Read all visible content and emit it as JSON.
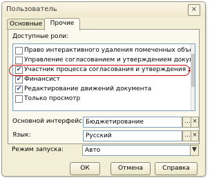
{
  "window": {
    "title": "Пользователь",
    "close_label": "×"
  },
  "tabs": [
    {
      "label": "Основные"
    },
    {
      "label": "Прочие"
    }
  ],
  "roles": {
    "label": "Доступные роли:",
    "items": [
      {
        "label": "Право интерактивного удаления помеченных объектов",
        "checked": false
      },
      {
        "label": "Управление согласованием и утверждением документов",
        "checked": false
      },
      {
        "label": "Участник процесса согласования и утверждения доку...",
        "checked": true
      },
      {
        "label": "Финансист",
        "checked": true
      },
      {
        "label": "Редактирование движений документа",
        "checked": true
      },
      {
        "label": "Только просмотр",
        "checked": false
      }
    ]
  },
  "fields": {
    "interface": {
      "label": "Основной интерфейс:",
      "value": "Бюджетирование"
    },
    "language": {
      "label": "Язык:",
      "value": "Русский"
    },
    "launch_mode": {
      "label": "Режим запуска:",
      "value": "Авто"
    }
  },
  "icons": {
    "ellipsis": "...",
    "clear": "×",
    "dropdown": "▼",
    "check": "✔"
  },
  "buttons": {
    "ok": "ОК",
    "cancel": "Отмена",
    "help": "Справка"
  }
}
